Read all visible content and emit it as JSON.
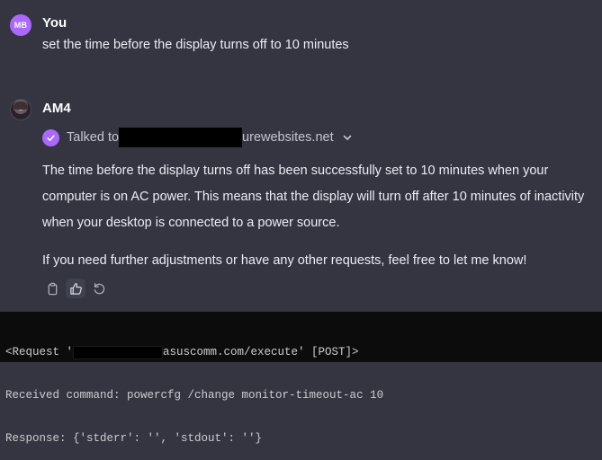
{
  "user_message": {
    "avatar_initials": "MB",
    "sender": "You",
    "text": "set the time before the display turns off to 10 minutes"
  },
  "assistant_message": {
    "sender": "AM4",
    "tool_call": {
      "prefix": "Talked to",
      "domain_suffix": "urewebsites.net"
    },
    "paragraphs": [
      "The time before the display turns off has been successfully set to 10 minutes when your computer is on AC power. This means that the display will turn off after 10 minutes of inactivity when your desktop is connected to a power source.",
      "If you need further adjustments or have any other requests, feel free to let me know!"
    ]
  },
  "terminal": {
    "line1_prefix": "<Request '",
    "line1_suffix": "asuscomm.com/execute' [POST]>",
    "line2": "Received command: powercfg /change monitor-timeout-ac 10",
    "line3": "Response: {'stderr': '', 'stdout': ''}"
  },
  "colors": {
    "background": "#343541",
    "accent": "#ab68ff",
    "terminal_bg": "#0c0c0c"
  },
  "icons": {
    "tool_status": "check-icon",
    "expand": "chevron-down-icon",
    "copy": "clipboard-icon",
    "like": "thumbs-up-icon",
    "regenerate": "refresh-icon"
  }
}
